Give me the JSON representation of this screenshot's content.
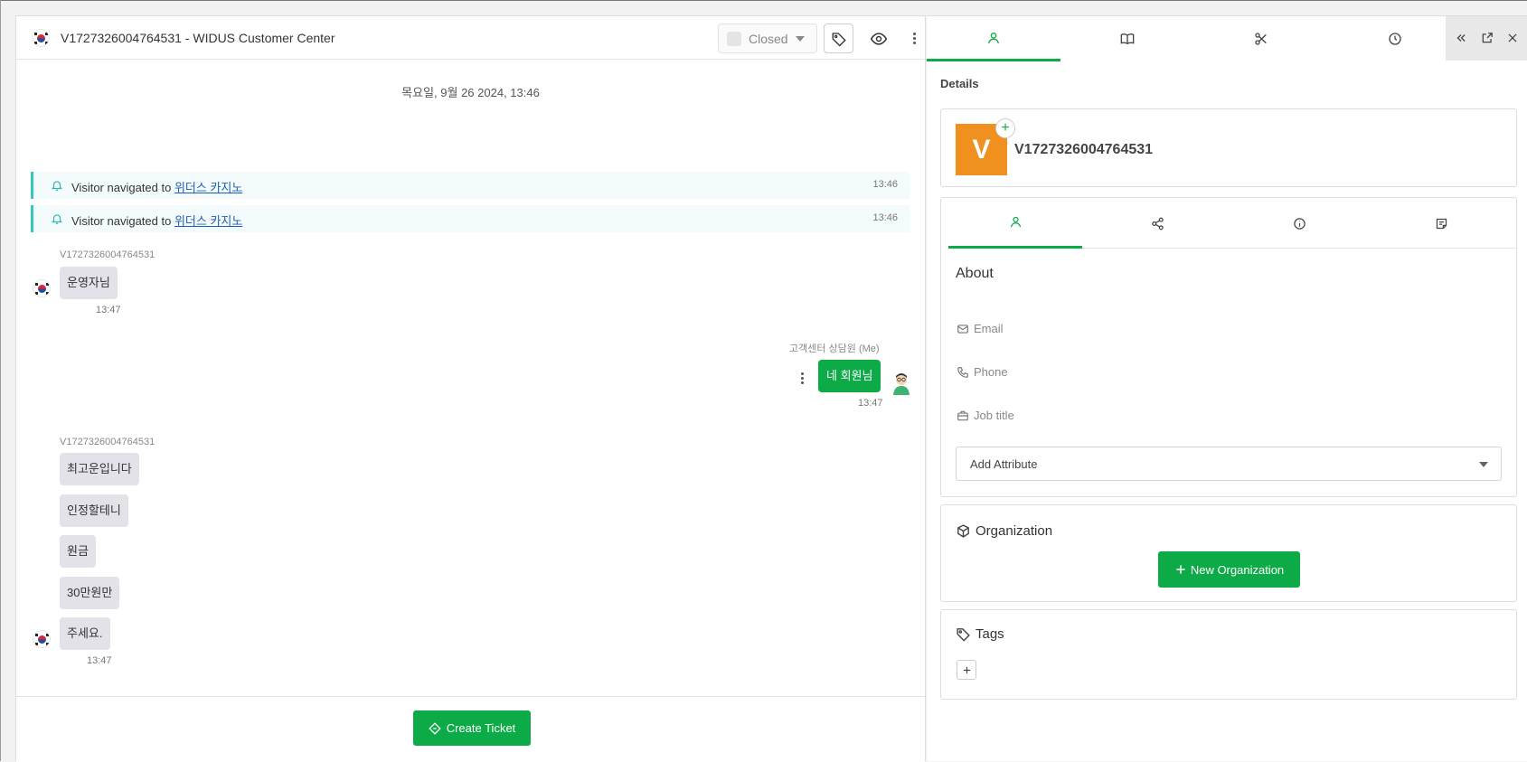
{
  "chat": {
    "header": {
      "title": "V1727326004764531 - WIDUS Customer Center",
      "status_label": "Closed",
      "flag_icon": "south-korea-flag-icon"
    },
    "date_separator": "목요일, 9월 26 2024, 13:46",
    "events": [
      {
        "prefix": "Visitor navigated to ",
        "link": "위더스 카지노",
        "time": "13:46"
      },
      {
        "prefix": "Visitor navigated to ",
        "link": "위더스 카지노",
        "time": "13:46"
      }
    ],
    "messages": {
      "visitor_1": {
        "sender": "V1727326004764531",
        "texts": [
          "운영자님"
        ],
        "time": "13:47"
      },
      "agent_1": {
        "sender": "고객센터 상담원 (Me)",
        "text": "네 회원님",
        "time": "13:47"
      },
      "visitor_2": {
        "sender": "V1727326004764531",
        "texts": [
          "최고운입니다",
          "인정할테니",
          "원금",
          "30만원만",
          "주세요."
        ],
        "time": "13:47"
      }
    },
    "footer": {
      "create_ticket_label": "Create Ticket"
    }
  },
  "side": {
    "details_label": "Details",
    "contact": {
      "avatar_letter": "V",
      "name": "V1727326004764531",
      "avatar_color": "#f0901f"
    },
    "about": {
      "title": "About",
      "fields": {
        "email": "Email",
        "phone": "Phone",
        "job_title": "Job title"
      },
      "add_attribute_label": "Add Attribute"
    },
    "organization": {
      "title": "Organization",
      "new_button_label": "New Organization"
    },
    "tags": {
      "title": "Tags"
    }
  },
  "colors": {
    "accent": "#0dab48",
    "event_border": "#34c7c0",
    "avatar": "#f0901f"
  }
}
